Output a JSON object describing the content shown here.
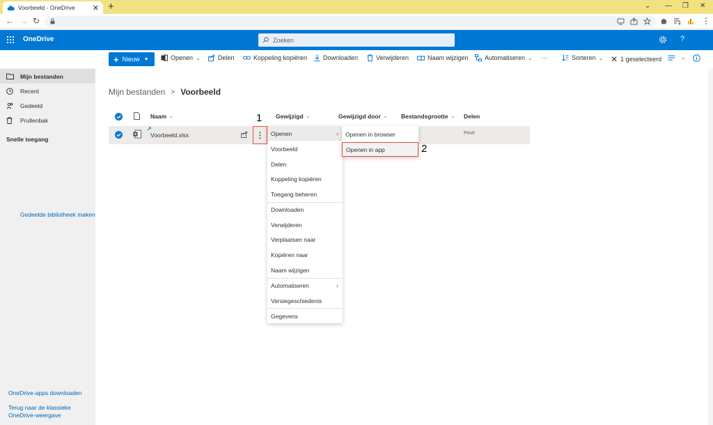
{
  "browser": {
    "tab_title": "Voorbeeld - OneDrive",
    "new_tab": "+",
    "close": "✕"
  },
  "header": {
    "brand": "OneDrive",
    "search_placeholder": "Zoeken",
    "settings_icon": "gear-icon",
    "help_label": "?"
  },
  "toolbar": {
    "new_label": "Nieuw",
    "open_label": "Openen",
    "share_label": "Delen",
    "copy_link_label": "Koppeling kopiëren",
    "download_label": "Downloaden",
    "delete_label": "Verwijderen",
    "rename_label": "Naam wijzigen",
    "automate_label": "Automatiseren",
    "more_label": "···",
    "sort_label": "Sorteren",
    "selected_label": "1 geselecteerd"
  },
  "sidebar": {
    "items": [
      {
        "label": "Mijn bestanden",
        "icon": "folder-icon"
      },
      {
        "label": "Recent",
        "icon": "clock-icon"
      },
      {
        "label": "Gedeeld",
        "icon": "people-icon"
      },
      {
        "label": "Prullenbak",
        "icon": "trash-icon"
      }
    ],
    "quick_access": "Snelle toegang",
    "create_library": "Gedeelde bibliotheek maken",
    "download_apps": "OneDrive-apps downloaden",
    "classic_line1": "Terug naar de klassieke",
    "classic_line2": "OneDrive-weergave"
  },
  "breadcrumb": {
    "root": "Mijn bestanden",
    "separator": ">",
    "current": "Voorbeeld"
  },
  "table": {
    "columns": [
      "Naam",
      "Gewijzigd",
      "Gewijzigd door",
      "Bestandsgrootte",
      "Delen"
    ],
    "rows": [
      {
        "name": "Voorbeeld.xlsx",
        "sharing": "Privé"
      }
    ]
  },
  "context_menu": {
    "items": [
      "Openen",
      "Voorbeeld",
      "Delen",
      "Koppeling kopiëren",
      "Toegang beheren",
      "Downloaden",
      "Verwijderen",
      "Verplaatsen naar",
      "Kopiëren naar",
      "Naam wijzigen",
      "Automatiseren",
      "Versiegeschiedenis",
      "Gegevens"
    ]
  },
  "submenu": {
    "items": [
      "Openen in browser",
      "Openen in app"
    ]
  },
  "annotations": {
    "step1": "1",
    "step2": "2"
  },
  "colors": {
    "accent": "#0078d4",
    "highlight_box": "#e74c3c",
    "chrome_tabbar": "#f3e181"
  }
}
